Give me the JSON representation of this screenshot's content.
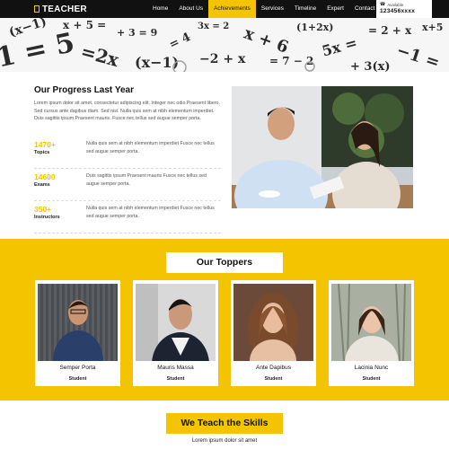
{
  "header": {
    "logo_text": "TEACHER",
    "nav": [
      {
        "label": "Home",
        "active": false
      },
      {
        "label": "About Us",
        "active": false
      },
      {
        "label": "Achievements",
        "active": true
      },
      {
        "label": "Services",
        "active": false
      },
      {
        "label": "Timeline",
        "active": false
      },
      {
        "label": "Expert",
        "active": false
      },
      {
        "label": "Contact Us",
        "active": false
      }
    ],
    "contact_label": "Available",
    "contact_phone": "123456xxxx"
  },
  "progress": {
    "title": "Our Progress Last Year",
    "description": "Lorem ipsum dolor sit amet, consectetur adipiscing elit. Integer nec odio.Praesent libero. Sed cursus ante dapibus diam. Sed nisi. Nulla quis sem at nibh elementum imperdiet. Duis sagittis ipsum.Praesent mauris. Fusce nec tellus sed augue semper porta.",
    "stats": [
      {
        "number": "1470+",
        "label": "Topics",
        "text": "Nulla quis sem at nibh elementum imperdiet Fusce nec tellus sed augue semper porta."
      },
      {
        "number": "14600",
        "label": "Exams",
        "text": "Duis sagittis ipsum Praesent mauris Fusce nec tellus sed augue semper porta."
      },
      {
        "number": "350+",
        "label": "Instructors",
        "text": "Nulla quis sem at nibh elementum imperdiet Fusce nec tellus sed augue semper porta."
      }
    ]
  },
  "toppers": {
    "title": "Our Toppers",
    "cards": [
      {
        "name": "Semper Porta",
        "role": "Student"
      },
      {
        "name": "Mauris Massa",
        "role": "Student"
      },
      {
        "name": "Ante Dapibus",
        "role": "Student"
      },
      {
        "name": "Lacinia Nunc",
        "role": "Student"
      }
    ]
  },
  "skills": {
    "title": "We Teach the Skills",
    "subtitle": "Lorem ipsum dolor sit amet"
  },
  "colors": {
    "accent": "#f5c400",
    "header_bg": "#111111"
  },
  "icons": {
    "logo": "book-icon",
    "phone": "phone-icon"
  }
}
